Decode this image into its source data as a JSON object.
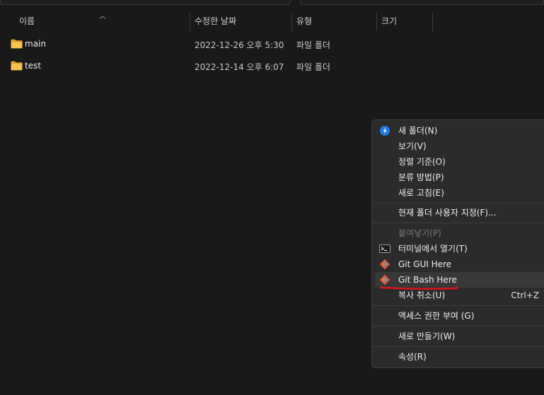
{
  "columns": {
    "name": "이름",
    "date_modified": "수정한 날짜",
    "type": "유형",
    "size": "크기"
  },
  "files": [
    {
      "name": "main",
      "date": "2022-12-26 오후 5:30",
      "type": "파일 폴더"
    },
    {
      "name": "test",
      "date": "2022-12-14 오후 6:07",
      "type": "파일 폴더"
    }
  ],
  "context_menu": {
    "new_folder": "새 폴더(N)",
    "view": "보기(V)",
    "sort_by": "정렬 기준(O)",
    "group_by": "분류 방법(P)",
    "refresh": "새로 고침(E)",
    "customize": "현재 폴더 사용자 지정(F)...",
    "paste": "붙여넣기(P)",
    "open_terminal": "터미널에서 열기(T)",
    "git_gui": "Git GUI Here",
    "git_bash": "Git Bash Here",
    "undo_copy": "복사 취소(U)",
    "undo_shortcut": "Ctrl+Z",
    "access": "액세스 권한 부여 (G)",
    "new": "새로 만들기(W)",
    "properties": "속성(R)"
  },
  "colors": {
    "background": "#191919",
    "menu_bg": "#2b2b2b",
    "folder": "#f5c24c",
    "annotation": "#d9141c"
  }
}
